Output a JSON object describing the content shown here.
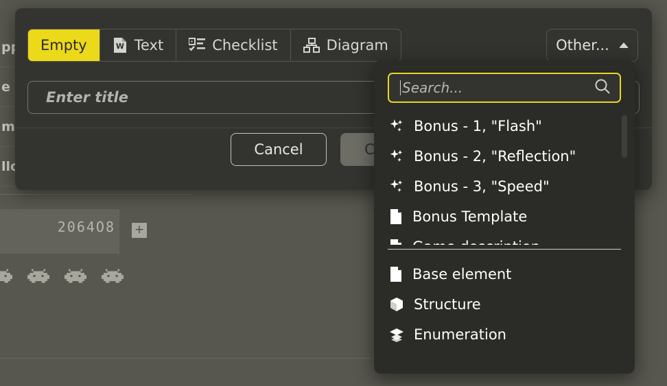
{
  "background": {
    "list_fragments": [
      "pp",
      "e",
      "m",
      "llo"
    ],
    "score": "2064O8",
    "add_label": "+",
    "invader_icon": "space-invader-icon"
  },
  "modal": {
    "tabs": [
      {
        "label": "Empty",
        "icon": "",
        "active": true
      },
      {
        "label": "Text",
        "icon": "word-document-icon",
        "active": false
      },
      {
        "label": "Checklist",
        "icon": "checklist-icon",
        "active": false
      },
      {
        "label": "Diagram",
        "icon": "hierarchy-diagram-icon",
        "active": false
      }
    ],
    "other_button": {
      "label": "Other...",
      "icon": "caret-up-icon"
    },
    "title_field": {
      "placeholder": "Enter title",
      "value": ""
    },
    "buttons": {
      "cancel": "Cancel",
      "create": "Create"
    }
  },
  "dropdown": {
    "search": {
      "placeholder": "Search...",
      "value": ""
    },
    "search_icon": "search-icon",
    "scroll_items": [
      {
        "label": "Bonus - 1, \"Flash\"",
        "icon": "sparkles-icon"
      },
      {
        "label": "Bonus - 2, \"Reflection\"",
        "icon": "sparkles-icon"
      },
      {
        "label": "Bonus - 3, \"Speed\"",
        "icon": "sparkles-icon"
      },
      {
        "label": "Bonus Template",
        "icon": "file-icon"
      },
      {
        "label": "Game description",
        "icon": "file-icon"
      }
    ],
    "bottom_items": [
      {
        "label": "Base element",
        "icon": "file-icon"
      },
      {
        "label": "Structure",
        "icon": "cube-icon"
      },
      {
        "label": "Enumeration",
        "icon": "layers-icon"
      }
    ]
  },
  "colors": {
    "accent_yellow": "#ebd91a",
    "modal_bg": "#333330",
    "dropdown_bg": "#2b2b28",
    "backdrop": "#57574f"
  }
}
